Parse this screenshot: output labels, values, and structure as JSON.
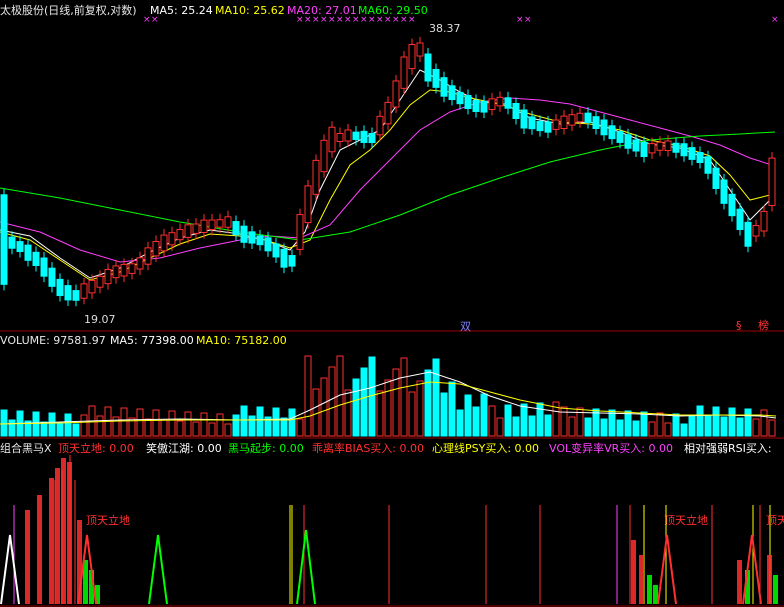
{
  "header": {
    "stock_label": "太极股份(日线,前复权,对数)",
    "ma5": "MA5: 25.24",
    "ma10": "MA10: 25.62",
    "ma20": "MA20: 27.01",
    "ma60": "MA60: 29.50"
  },
  "price": {
    "high_label": "38.37",
    "low_label": "19.07",
    "right_badges": [
      "§",
      "榜"
    ],
    "mid_badge": "双"
  },
  "volume": {
    "label": "VOLUME: 97581.97",
    "ma5": "MA5: 77398.00",
    "ma10": "MA10: 75182.00"
  },
  "indicator": {
    "title": "组合黑马X",
    "items": [
      {
        "label": "顶天立地: 0.00",
        "color": "#ff3030"
      },
      {
        "label": "笑傲江湖: 0.00",
        "color": "#ffffff"
      },
      {
        "label": "黑马起步: 0.00",
        "color": "#00ff00"
      },
      {
        "label": "乖离率BIAS买入: 0.00",
        "color": "#ff3030"
      },
      {
        "label": "心理线PSY买入: 0.00",
        "color": "#ffff00"
      },
      {
        "label": "VOL变异率VR买入: 0.00",
        "color": "#ff40ff"
      },
      {
        "label": "相对强弱RSI买入:",
        "color": "#ffffff"
      }
    ],
    "annotations": [
      "顶天立地",
      "顶天立地",
      "顶天"
    ]
  },
  "colors": {
    "up": "#ff3030",
    "down": "#00ffff",
    "ma5": "#ffffff",
    "ma10": "#ffff00",
    "ma20": "#ff40ff",
    "ma60": "#00ff00",
    "grid": "#a00000"
  }
}
